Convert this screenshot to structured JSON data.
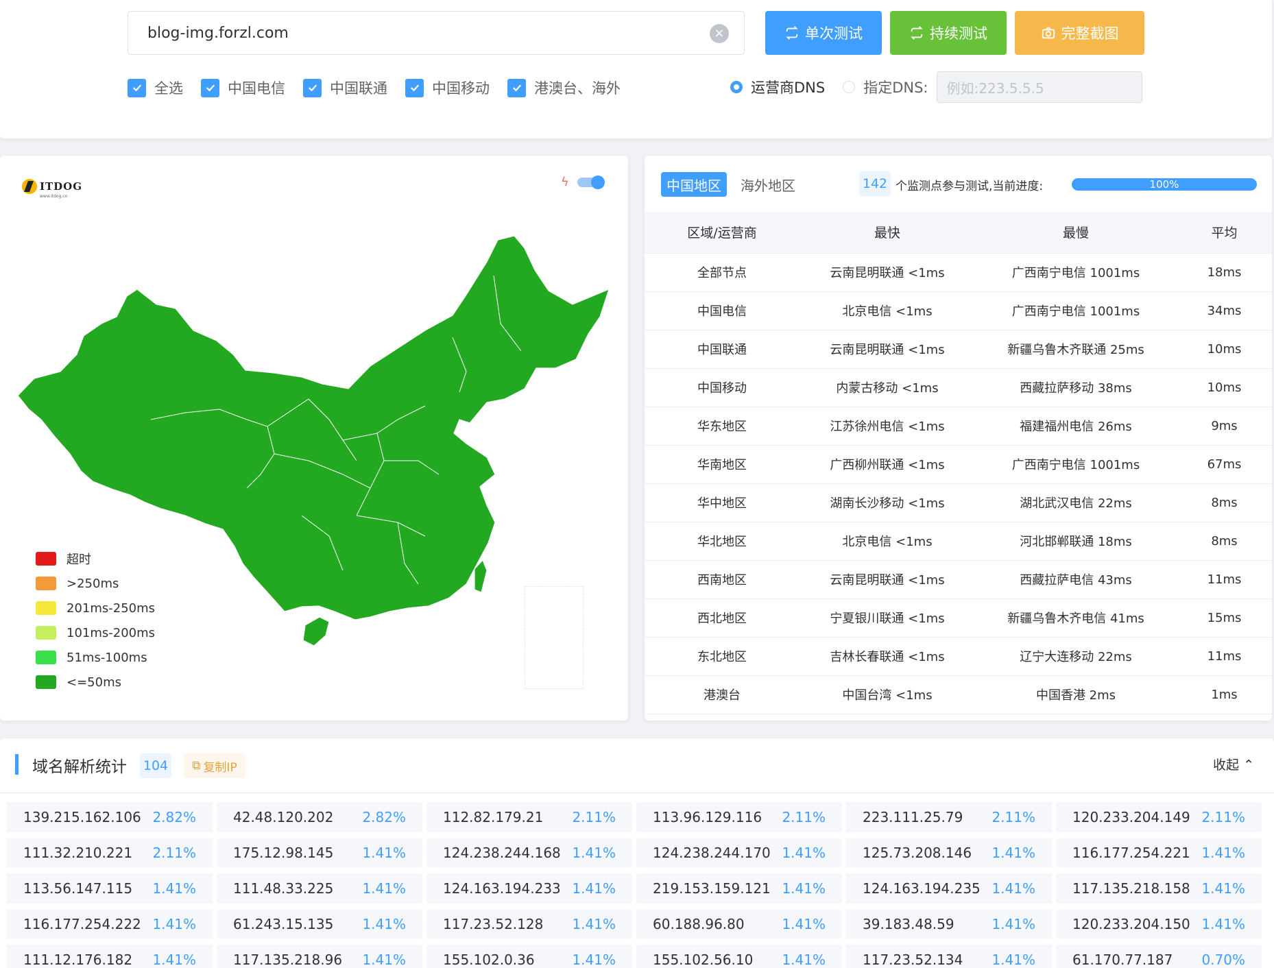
{
  "header": {
    "url_value": "blog-img.forzl.com",
    "buttons": {
      "single": "单次测试",
      "continuous": "持续测试",
      "screenshot": "完整截图"
    },
    "checkboxes": [
      {
        "label": "全选",
        "checked": true
      },
      {
        "label": "中国电信",
        "checked": true
      },
      {
        "label": "中国联通",
        "checked": true
      },
      {
        "label": "中国移动",
        "checked": true
      },
      {
        "label": "港澳台、海外",
        "checked": true
      }
    ],
    "dns": {
      "isp_label": "运营商DNS",
      "custom_label": "指定DNS:",
      "selected": "isp",
      "placeholder": "例如:223.5.5.5"
    }
  },
  "map": {
    "logo_text": "ITDOG",
    "logo_sub": "www.itdog.cn",
    "legend": [
      {
        "label": "超时",
        "color": "#e31a1c"
      },
      {
        "label": ">250ms",
        "color": "#f59a38"
      },
      {
        "label": "201ms-250ms",
        "color": "#f5e83b"
      },
      {
        "label": "101ms-200ms",
        "color": "#c5f05e"
      },
      {
        "label": "51ms-100ms",
        "color": "#3ae04a"
      },
      {
        "label": "<=50ms",
        "color": "#22a821"
      }
    ],
    "fill_color": "#22a821"
  },
  "stats": {
    "tabs": [
      {
        "label": "中国地区",
        "active": true
      },
      {
        "label": "海外地区",
        "active": false
      }
    ],
    "node_count": "142",
    "progress_text": "个监测点参与测试,当前进度:",
    "progress": 1.0,
    "progress_label": "100%",
    "columns": [
      "区域/运营商",
      "最快",
      "最慢",
      "平均"
    ],
    "rows": [
      [
        "全部节点",
        "云南昆明联通 <1ms",
        "广西南宁电信 1001ms",
        "18ms"
      ],
      [
        "中国电信",
        "北京电信 <1ms",
        "广西南宁电信 1001ms",
        "34ms"
      ],
      [
        "中国联通",
        "云南昆明联通 <1ms",
        "新疆乌鲁木齐联通 25ms",
        "10ms"
      ],
      [
        "中国移动",
        "内蒙古移动 <1ms",
        "西藏拉萨移动 38ms",
        "10ms"
      ],
      [
        "华东地区",
        "江苏徐州电信 <1ms",
        "福建福州电信 26ms",
        "9ms"
      ],
      [
        "华南地区",
        "广西柳州联通 <1ms",
        "广西南宁电信 1001ms",
        "67ms"
      ],
      [
        "华中地区",
        "湖南长沙移动 <1ms",
        "湖北武汉电信 22ms",
        "8ms"
      ],
      [
        "华北地区",
        "北京电信 <1ms",
        "河北邯郸联通 18ms",
        "8ms"
      ],
      [
        "西南地区",
        "云南昆明联通 <1ms",
        "西藏拉萨电信 43ms",
        "11ms"
      ],
      [
        "西北地区",
        "宁夏银川联通 <1ms",
        "新疆乌鲁木齐电信 41ms",
        "15ms"
      ],
      [
        "东北地区",
        "吉林长春联通 <1ms",
        "辽宁大连移动 22ms",
        "11ms"
      ],
      [
        "港澳台",
        "中国台湾 <1ms",
        "中国香港 2ms",
        "1ms"
      ]
    ]
  },
  "resolution": {
    "title": "域名解析统计",
    "count": "104",
    "copy_label": "复制IP",
    "collapse_label": "收起",
    "ips": [
      {
        "ip": "139.215.162.106",
        "pct": "2.82%"
      },
      {
        "ip": "42.48.120.202",
        "pct": "2.82%"
      },
      {
        "ip": "112.82.179.21",
        "pct": "2.11%"
      },
      {
        "ip": "113.96.129.116",
        "pct": "2.11%"
      },
      {
        "ip": "223.111.25.79",
        "pct": "2.11%"
      },
      {
        "ip": "120.233.204.149",
        "pct": "2.11%"
      },
      {
        "ip": "111.32.210.221",
        "pct": "2.11%"
      },
      {
        "ip": "175.12.98.145",
        "pct": "1.41%"
      },
      {
        "ip": "124.238.244.168",
        "pct": "1.41%"
      },
      {
        "ip": "124.238.244.170",
        "pct": "1.41%"
      },
      {
        "ip": "125.73.208.146",
        "pct": "1.41%"
      },
      {
        "ip": "116.177.254.221",
        "pct": "1.41%"
      },
      {
        "ip": "113.56.147.115",
        "pct": "1.41%"
      },
      {
        "ip": "111.48.33.225",
        "pct": "1.41%"
      },
      {
        "ip": "124.163.194.233",
        "pct": "1.41%"
      },
      {
        "ip": "219.153.159.121",
        "pct": "1.41%"
      },
      {
        "ip": "124.163.194.235",
        "pct": "1.41%"
      },
      {
        "ip": "117.135.218.158",
        "pct": "1.41%"
      },
      {
        "ip": "116.177.254.222",
        "pct": "1.41%"
      },
      {
        "ip": "61.243.15.135",
        "pct": "1.41%"
      },
      {
        "ip": "117.23.52.128",
        "pct": "1.41%"
      },
      {
        "ip": "60.188.96.80",
        "pct": "1.41%"
      },
      {
        "ip": "39.183.48.59",
        "pct": "1.41%"
      },
      {
        "ip": "120.233.204.150",
        "pct": "1.41%"
      },
      {
        "ip": "111.12.176.182",
        "pct": "1.41%"
      },
      {
        "ip": "117.135.218.96",
        "pct": "1.41%"
      },
      {
        "ip": "155.102.0.36",
        "pct": "1.41%"
      },
      {
        "ip": "155.102.56.10",
        "pct": "1.41%"
      },
      {
        "ip": "117.23.52.134",
        "pct": "1.41%"
      },
      {
        "ip": "61.170.77.187",
        "pct": "0.70%"
      }
    ]
  }
}
